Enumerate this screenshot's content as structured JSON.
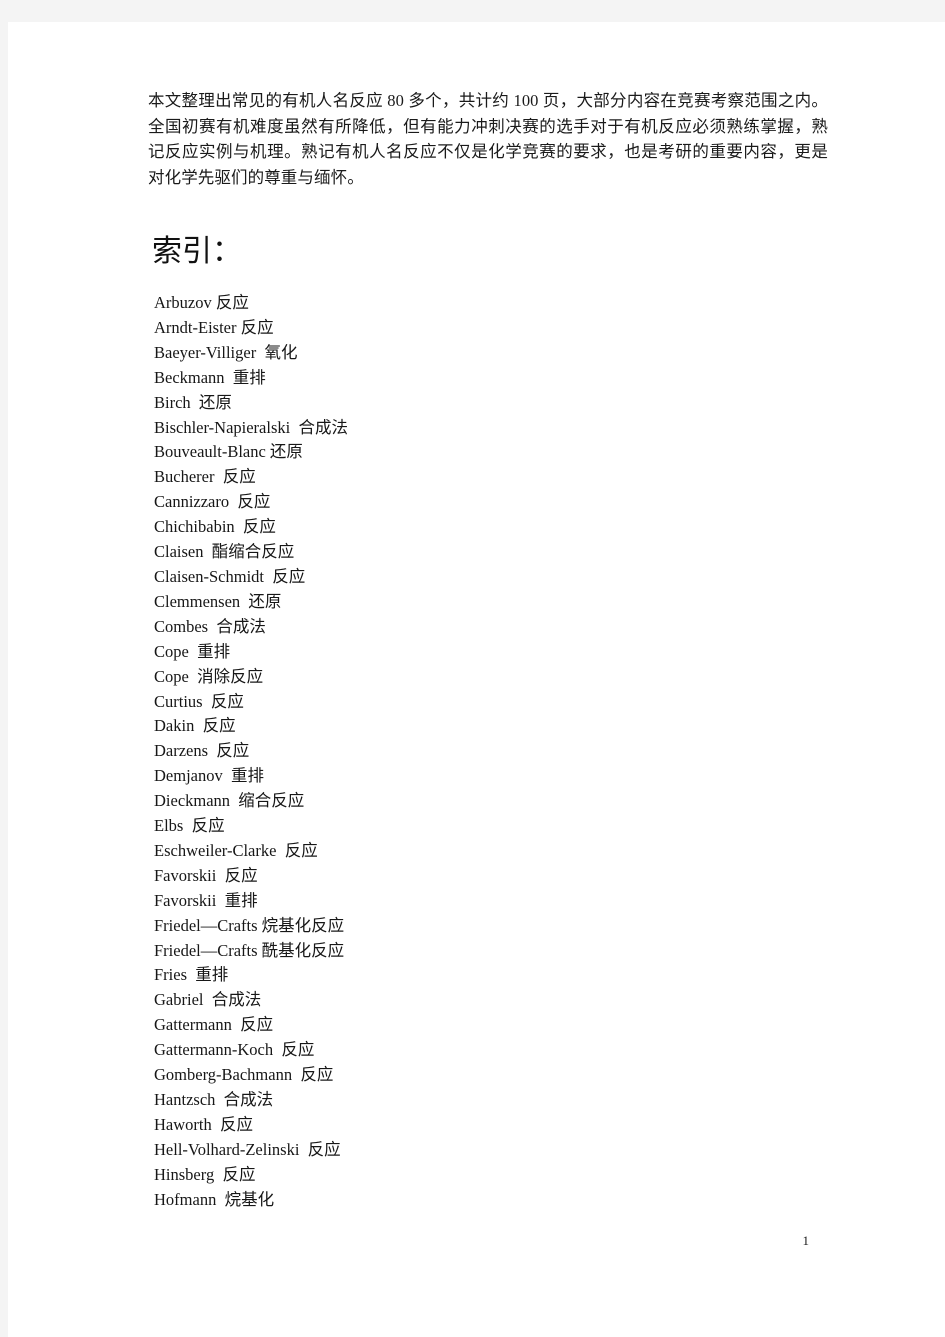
{
  "document": {
    "intro_paragraph": "本文整理出常见的有机人名反应 80 多个，共计约 100 页，大部分内容在竞赛考察范围之内。全国初赛有机难度虽然有所降低，但有能力冲刺决赛的选手对于有机反应必须熟练掌握，熟记反应实例与机理。熟记有机人名反应不仅是化学竞赛的要求，也是考研的重要内容，更是对化学先驱们的尊重与缅怀。",
    "index_heading": "索引：",
    "page_number": "1",
    "index_entries": [
      "Arbuzov 反应",
      "Arndt-Eister 反应",
      "Baeyer-Villiger  氧化",
      "Beckmann  重排",
      "Birch  还原",
      "Bischler-Napieralski  合成法",
      "Bouveault-Blanc 还原",
      "Bucherer  反应",
      "Cannizzaro  反应",
      "Chichibabin  反应",
      "Claisen  酯缩合反应",
      "Claisen-Schmidt  反应",
      "Clemmensen  还原",
      "Combes  合成法",
      "Cope  重排",
      "Cope  消除反应",
      "Curtius  反应",
      "Dakin  反应",
      "Darzens  反应",
      "Demjanov  重排",
      "Dieckmann  缩合反应",
      "Elbs  反应",
      "Eschweiler-Clarke  反应",
      "Favorskii  反应",
      "Favorskii  重排",
      "Friedel—Crafts 烷基化反应",
      "Friedel—Crafts 酰基化反应",
      "Fries  重排",
      "Gabriel  合成法",
      "Gattermann  反应",
      "Gattermann-Koch  反应",
      "Gomberg-Bachmann  反应",
      "Hantzsch  合成法",
      "Haworth  反应",
      "Hell-Volhard-Zelinski  反应",
      "Hinsberg  反应",
      "Hofmann  烷基化"
    ]
  }
}
